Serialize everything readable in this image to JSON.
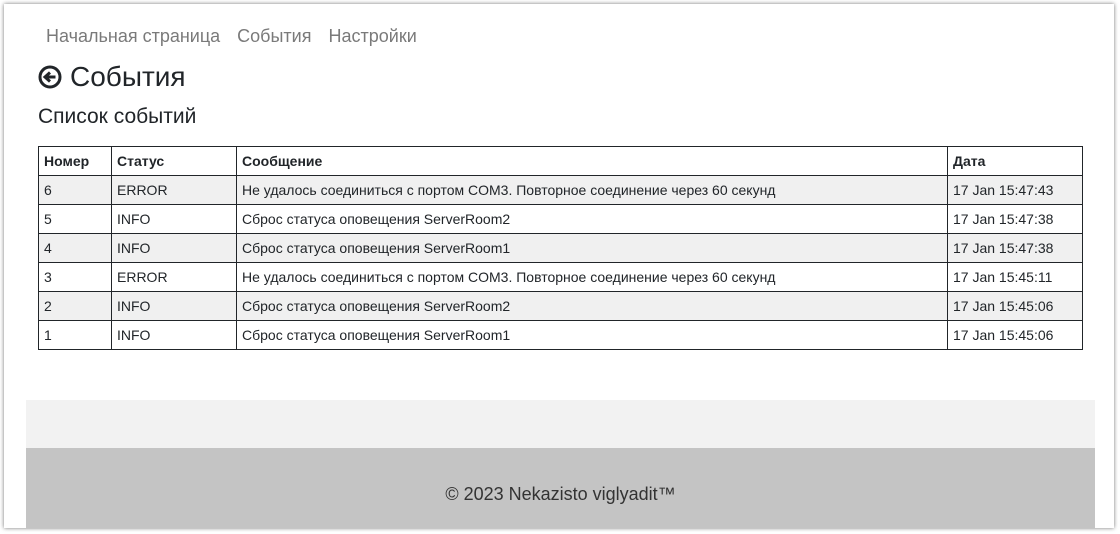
{
  "nav": {
    "items": [
      "Начальная страница",
      "События",
      "Настройки"
    ]
  },
  "page": {
    "title": "События",
    "back_icon": "arrow-circle-left-icon",
    "subtitle": "Список событий"
  },
  "table": {
    "headers": [
      "Номер",
      "Статус",
      "Сообщение",
      "Дата"
    ],
    "rows": [
      [
        "6",
        "ERROR",
        "Не удалось соединиться с портом COM3. Повторное соединение через 60 секунд",
        "17 Jan 15:47:43"
      ],
      [
        "5",
        "INFO",
        "Сброс статуса оповещения ServerRoom2",
        "17 Jan 15:47:38"
      ],
      [
        "4",
        "INFO",
        "Сброс статуса оповещения ServerRoom1",
        "17 Jan 15:47:38"
      ],
      [
        "3",
        "ERROR",
        "Не удалось соединиться с портом COM3. Повторное соединение через 60 секунд",
        "17 Jan 15:45:11"
      ],
      [
        "2",
        "INFO",
        "Сброс статуса оповещения ServerRoom2",
        "17 Jan 15:45:06"
      ],
      [
        "1",
        "INFO",
        "Сброс статуса оповещения ServerRoom1",
        "17 Jan 15:45:06"
      ]
    ]
  },
  "footer": {
    "copyright": "© 2023 Nekazisto viglyadit™"
  }
}
